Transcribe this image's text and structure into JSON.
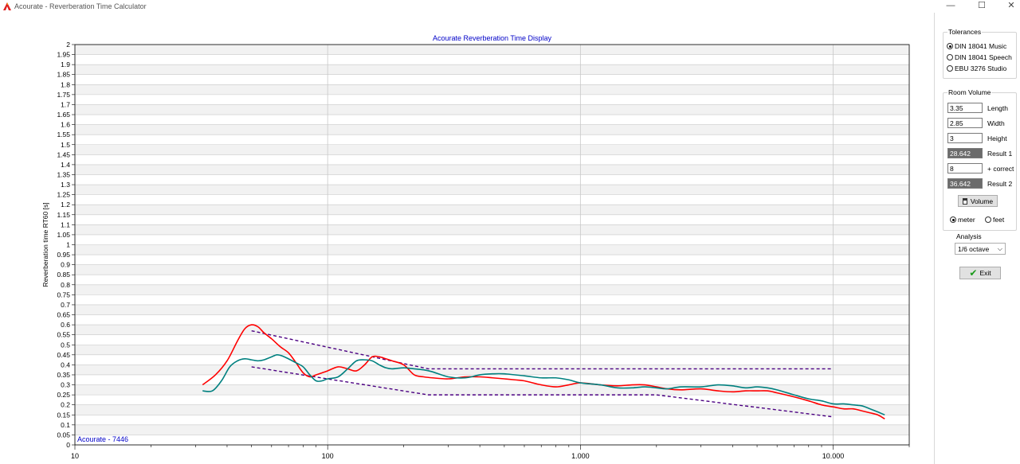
{
  "window": {
    "title": "Acourate - Reverberation Time Calculator",
    "minimize_glyph": "—",
    "maximize_glyph": "☐",
    "close_glyph": "✕",
    "icon": "acourate-logo-icon"
  },
  "chart_data": {
    "type": "line",
    "title": "Acourate Reverberation Time Display",
    "ylabel": "Reverberation time RT60 [s]",
    "xlabel": "",
    "x_scale": "log",
    "xlim": [
      10,
      20000
    ],
    "ylim": [
      0,
      2
    ],
    "x_ticks": [
      {
        "value": 10,
        "label": "10"
      },
      {
        "value": 100,
        "label": "100"
      },
      {
        "value": 1000,
        "label": "1.000"
      },
      {
        "value": 10000,
        "label": "10.000"
      }
    ],
    "y_ticks": [
      "0",
      "0.05",
      "0.1",
      "0.15",
      "0.2",
      "0.25",
      "0.3",
      "0.35",
      "0.4",
      "0.45",
      "0.5",
      "0.55",
      "0.6",
      "0.65",
      "0.7",
      "0.75",
      "0.8",
      "0.85",
      "0.9",
      "0.95",
      "1",
      "1.05",
      "1.1",
      "1.15",
      "1.2",
      "1.25",
      "1.3",
      "1.35",
      "1.4",
      "1.45",
      "1.5",
      "1.55",
      "1.6",
      "1.65",
      "1.7",
      "1.75",
      "1.8",
      "1.85",
      "1.9",
      "1.95",
      "2"
    ],
    "grid": true,
    "annotation": "Acourate - 7446",
    "colors": {
      "title": "#0000c8",
      "annotation": "#0000c8",
      "tolerance": "#4b0082",
      "red": "#ff0000",
      "teal": "#00807f",
      "grid": "#c8c8c8",
      "band": "#f2f2f2"
    },
    "series": [
      {
        "color": "#ff0000",
        "x": [
          32,
          36,
          40,
          44,
          47,
          50,
          53,
          56,
          60,
          65,
          70,
          75,
          80,
          85,
          90,
          95,
          100,
          110,
          120,
          130,
          140,
          150,
          160,
          170,
          180,
          200,
          220,
          240,
          260,
          300,
          350,
          400,
          450,
          500,
          550,
          600,
          700,
          800,
          900,
          1000,
          1200,
          1400,
          1600,
          1800,
          2000,
          2200,
          2500,
          3000,
          3500,
          4000,
          4500,
          5000,
          5500,
          6000,
          7000,
          8000,
          9000,
          10000,
          11000,
          12000,
          13000,
          14000,
          15000,
          16000
        ],
        "values": [
          0.3,
          0.35,
          0.42,
          0.52,
          0.58,
          0.6,
          0.59,
          0.56,
          0.53,
          0.49,
          0.46,
          0.41,
          0.36,
          0.34,
          0.35,
          0.36,
          0.37,
          0.39,
          0.38,
          0.37,
          0.4,
          0.44,
          0.44,
          0.43,
          0.42,
          0.4,
          0.35,
          0.34,
          0.335,
          0.33,
          0.34,
          0.34,
          0.335,
          0.33,
          0.325,
          0.32,
          0.3,
          0.29,
          0.3,
          0.31,
          0.3,
          0.295,
          0.3,
          0.3,
          0.29,
          0.28,
          0.275,
          0.28,
          0.27,
          0.265,
          0.27,
          0.27,
          0.27,
          0.26,
          0.24,
          0.22,
          0.2,
          0.19,
          0.18,
          0.18,
          0.17,
          0.16,
          0.15,
          0.13
        ]
      },
      {
        "color": "#00807f",
        "x": [
          32,
          35,
          38,
          41,
          44,
          47,
          50,
          53,
          56,
          60,
          63,
          66,
          70,
          75,
          80,
          85,
          90,
          95,
          100,
          110,
          120,
          130,
          140,
          150,
          160,
          170,
          180,
          200,
          220,
          240,
          260,
          300,
          350,
          400,
          450,
          500,
          600,
          700,
          800,
          900,
          1000,
          1200,
          1400,
          1600,
          1800,
          2000,
          2200,
          2500,
          3000,
          3500,
          4000,
          4500,
          5000,
          5500,
          6000,
          7000,
          8000,
          9000,
          10000,
          11000,
          12000,
          13000,
          14000,
          15000,
          16000
        ],
        "values": [
          0.27,
          0.27,
          0.32,
          0.39,
          0.42,
          0.43,
          0.425,
          0.42,
          0.425,
          0.44,
          0.45,
          0.445,
          0.43,
          0.41,
          0.39,
          0.35,
          0.32,
          0.32,
          0.33,
          0.34,
          0.38,
          0.42,
          0.425,
          0.42,
          0.4,
          0.385,
          0.38,
          0.385,
          0.38,
          0.375,
          0.365,
          0.34,
          0.335,
          0.35,
          0.355,
          0.355,
          0.345,
          0.335,
          0.335,
          0.325,
          0.31,
          0.3,
          0.285,
          0.285,
          0.29,
          0.285,
          0.28,
          0.29,
          0.29,
          0.3,
          0.295,
          0.285,
          0.29,
          0.285,
          0.275,
          0.25,
          0.23,
          0.22,
          0.205,
          0.205,
          0.2,
          0.195,
          0.18,
          0.165,
          0.15
        ]
      }
    ],
    "tolerance_lines": [
      {
        "x": [
          50,
          250,
          10000
        ],
        "values": [
          0.57,
          0.38,
          0.38
        ]
      },
      {
        "x": [
          50,
          250,
          2000,
          10000
        ],
        "values": [
          0.39,
          0.25,
          0.25,
          0.14
        ]
      }
    ]
  },
  "panel": {
    "tolerances": {
      "title": "Tolerances",
      "options": [
        {
          "label": "DIN 18041 Music",
          "selected": true
        },
        {
          "label": "DIN 18041 Speech",
          "selected": false
        },
        {
          "label": "EBU 3276 Studio",
          "selected": false
        }
      ]
    },
    "room_volume": {
      "title": "Room Volume",
      "fields": [
        {
          "value": "3.35",
          "label": "Length",
          "readonly": false
        },
        {
          "value": "2.85",
          "label": "Width",
          "readonly": false
        },
        {
          "value": "3",
          "label": "Height",
          "readonly": false
        },
        {
          "value": "28.642",
          "label": "Result 1",
          "readonly": true
        },
        {
          "value": "8",
          "label": "+ correct",
          "readonly": false
        },
        {
          "value": "36.642",
          "label": "Result 2",
          "readonly": true
        }
      ],
      "volume_button": "Volume",
      "units": [
        {
          "label": "meter",
          "selected": true
        },
        {
          "label": "feet",
          "selected": false
        }
      ]
    },
    "analysis": {
      "label": "Analysis",
      "value": "1/6 octave",
      "arrow": "⌵"
    },
    "exit_button": "Exit"
  }
}
